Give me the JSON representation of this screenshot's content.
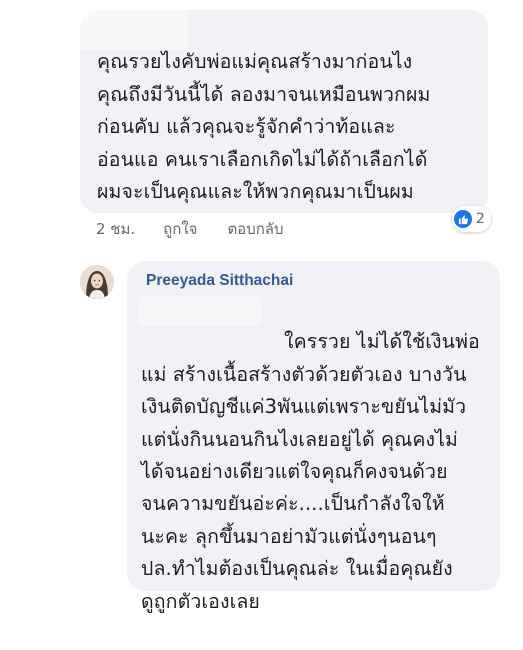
{
  "comment1": {
    "text": "คุณรวยไงคับพ่อแม่คุณสร้างมาก่อนไง\nคุณถึงมีวันนี้ได้ ลองมาจนเหมือนพวกผม\nก่อนคับ แล้วคุณจะรู้จักคำว่าท้อและ\nอ่อนแอ คนเราเลือกเกิดไม่ได้ถ้าเลือกได้\nผมจะเป็นคุณและให้พวกคุณมาเป็นผม",
    "time": "2 ชม.",
    "like_label": "ถูกใจ",
    "reply_label": "ตอบกลับ",
    "reaction_count": "2"
  },
  "reply": {
    "author": "Preeyada Sitthachai",
    "text": "ใครรวย ไม่ได้ใช้เงินพ่อ\nแม่ สร้างเนื้อสร้างตัวด้วยตัวเอง บางวัน\nเงินติดบัญชีแค่3พันแต่เพราะขยันไม่มัว\nแต่นั่งกินนอนกินไงเลยอยู่ได้ คุณคงไม่\nได้จนอย่างเดียวแต่ใจคุณก็คงจนด้วย\nจนความขยันอ่ะค่ะ....เป็นกำลังใจให้\nนะคะ ลุกขึ้นมาอย่ามัวแต่นั่งๆนอนๆ\nปล.ทำไมต้องเป็นคุณล่ะ ในเมื่อคุณยัง\nดูถูกตัวเองเลย"
  },
  "colors": {
    "bubble": "#f0f2f5",
    "author": "#385898",
    "meta": "#65676b",
    "like_blue": "#1877f2"
  },
  "icons": {
    "reaction": "thumbs-up-icon",
    "avatar": "profile-photo"
  }
}
